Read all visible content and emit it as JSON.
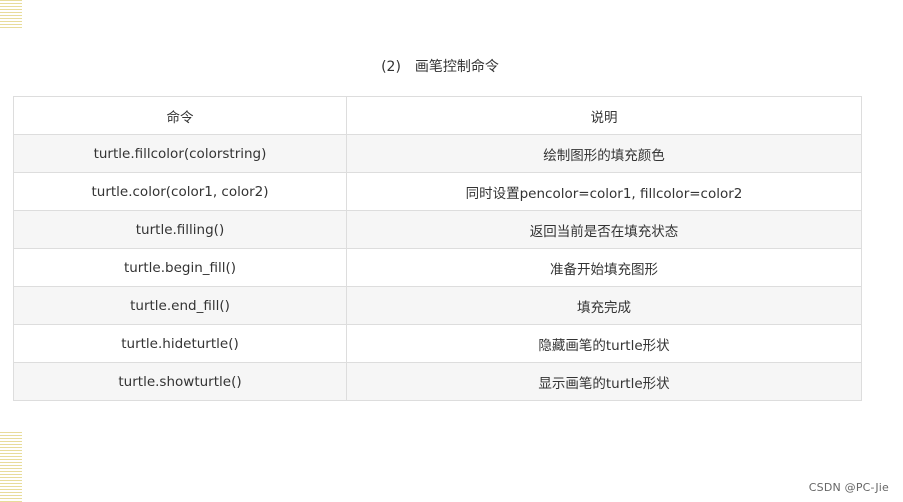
{
  "caption": {
    "number": "(2)",
    "title": "画笔控制命令"
  },
  "table": {
    "headers": [
      "命令",
      "说明"
    ],
    "rows": [
      {
        "command": "turtle.fillcolor(colorstring)",
        "description": "绘制图形的填充颜色"
      },
      {
        "command": "turtle.color(color1, color2)",
        "description": "同时设置pencolor=color1, fillcolor=color2"
      },
      {
        "command": "turtle.filling()",
        "description": "返回当前是否在填充状态"
      },
      {
        "command": "turtle.begin_fill()",
        "description": "准备开始填充图形"
      },
      {
        "command": "turtle.end_fill()",
        "description": "填充完成"
      },
      {
        "command": "turtle.hideturtle()",
        "description": "隐藏画笔的turtle形状"
      },
      {
        "command": "turtle.showturtle()",
        "description": "显示画笔的turtle形状"
      }
    ]
  },
  "watermark": "CSDN @PC-Jie",
  "colors": {
    "border": "#dddddd",
    "row_alt": "#f6f6f6",
    "text": "#333333",
    "deco_stripe": "#e8dc9a"
  }
}
